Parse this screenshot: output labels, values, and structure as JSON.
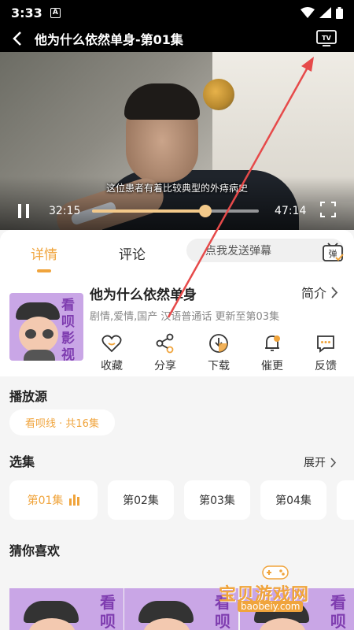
{
  "status": {
    "time": "3:33",
    "a_badge": "A"
  },
  "header": {
    "title": "他为什么依然单身-第01集",
    "tv_label": "TV"
  },
  "video": {
    "subtitle": "这位患者有着比较典型的外痔病史"
  },
  "player": {
    "current_time": "32:15",
    "total_time": "47:14",
    "progress": 0.68
  },
  "tabs": {
    "details": "详情",
    "comments": "评论",
    "danmu_placeholder": "点我发送弹幕",
    "danmu_icon_label": "弹"
  },
  "detail": {
    "poster_text": "看呗影视",
    "title": "他为什么依然单身",
    "intro": "简介",
    "tags": "剧情,爱情,国产 汉语普通话 更新至第03集",
    "actions": {
      "collect": "收藏",
      "share": "分享",
      "download": "下载",
      "urge": "催更",
      "feedback": "反馈"
    }
  },
  "source": {
    "title": "播放源",
    "selected": "看呗线 · 共16集"
  },
  "episodes": {
    "title": "选集",
    "expand": "展开",
    "items": [
      "第01集",
      "第02集",
      "第03集",
      "第04集"
    ]
  },
  "recommend": {
    "title": "猜你喜欢",
    "poster_text": "看呗"
  },
  "watermark": {
    "text": "宝贝游戏网",
    "url": "baobeiy.com"
  },
  "colors": {
    "accent": "#f0a43c",
    "poster_bg": "#c9a6e6",
    "annotation_arrow": "#e64a4a"
  }
}
